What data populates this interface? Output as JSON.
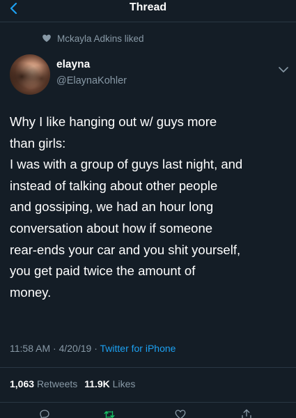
{
  "nav": {
    "title": "Thread"
  },
  "social_context": {
    "text": "Mckayla Adkins liked"
  },
  "user": {
    "name": "elayna",
    "handle": "@ElaynaKohler"
  },
  "tweet": {
    "lines": [
      "Why I like hanging out w/ guys more",
      "than girls:",
      "I was with a group of guys last night, and",
      "instead of talking about other people",
      "and gossiping, we had an hour long",
      "conversation about how if someone",
      "rear-ends your car and you shit yourself,",
      "you get paid twice the amount of",
      "money."
    ],
    "time": "11:58 AM",
    "date": "4/20/19",
    "separator": "·",
    "source": "Twitter for iPhone"
  },
  "stats": {
    "retweets_count": "1,063",
    "retweets_label": "Retweets",
    "likes_count": "11.9K",
    "likes_label": "Likes"
  },
  "icons": {
    "back": "chevron-left-icon",
    "heart": "heart-icon",
    "caret": "chevron-down-icon",
    "reply": "reply-icon",
    "retweet": "retweet-icon",
    "like": "like-icon",
    "share": "share-icon"
  },
  "colors": {
    "background": "#141d26",
    "accent": "#1da1f2",
    "secondary_text": "#8899a6",
    "divider": "#2a3744",
    "retweet_green": "#17bf63"
  }
}
